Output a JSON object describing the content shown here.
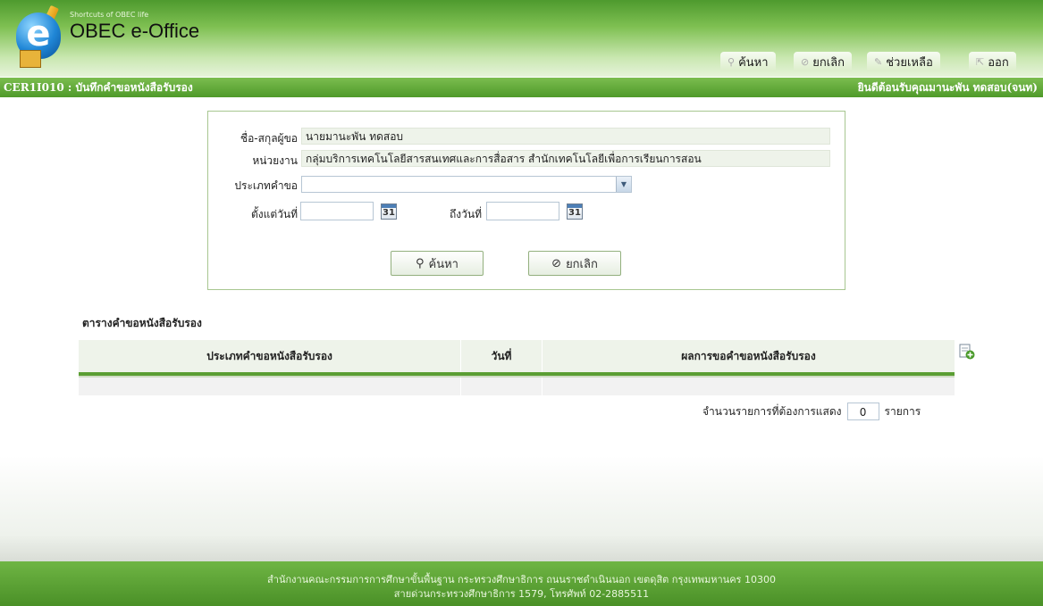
{
  "header": {
    "tagline": "Shortcuts of OBEC life",
    "app_title": "OBEC e-Office",
    "menu": [
      {
        "label": "ค้นหา",
        "icon": "search-icon"
      },
      {
        "label": "ยกเลิก",
        "icon": "cancel-icon"
      },
      {
        "label": "ช่วยเหลือ",
        "icon": "help-icon"
      },
      {
        "label": "ออก",
        "icon": "exit-icon"
      }
    ]
  },
  "titlebar": {
    "page_code_title": "CER1I010 : บันทึกคำขอหนังสือรับรอง",
    "welcome": "ยินดีต้อนรับคุณมานะพัน ทดสอบ(จนท)"
  },
  "search": {
    "name_label": "ชื่อ-สกุลผู้ขอ",
    "name_value": "นายมานะพัน ทดสอบ",
    "unit_label": "หน่วยงาน",
    "unit_value": "กลุ่มบริการเทคโนโลยีสารสนเทศและการสื่อสาร  สำนักเทคโนโลยีเพื่อการเรียนการสอน",
    "type_label": "ประเภทคำขอ",
    "type_value": "",
    "from_label": "ตั้งแต่วันที่",
    "to_label": "ถึงวันที่",
    "from_value": "",
    "to_value": "",
    "calendar_text": "31",
    "search_button": "ค้นหา",
    "cancel_button": "ยกเลิก"
  },
  "table": {
    "title": "ตารางคำขอหนังสือรับรอง",
    "columns": [
      "ประเภทคำขอหนังสือรับรอง",
      "วันที่",
      "ผลการขอคำขอหนังสือรับรอง"
    ],
    "rows": [],
    "count_label": "จำนวนรายการที่ต้องการแสดง",
    "count_value": "0",
    "count_unit": "รายการ"
  },
  "footer": {
    "line1": "สำนักงานคณะกรรมการการศึกษาขั้นพื้นฐาน กระทรวงศึกษาธิการ ถนนราชดำเนินนอก เขตดุสิต กรุงเทพมหานคร 10300",
    "line2": "สายด่วนกระทรวงศึกษาธิการ 1579, โทรศัพท์ 02-2885511"
  },
  "colors": {
    "brand_green": "#5b9e33",
    "header_light": "#e6f3da"
  }
}
